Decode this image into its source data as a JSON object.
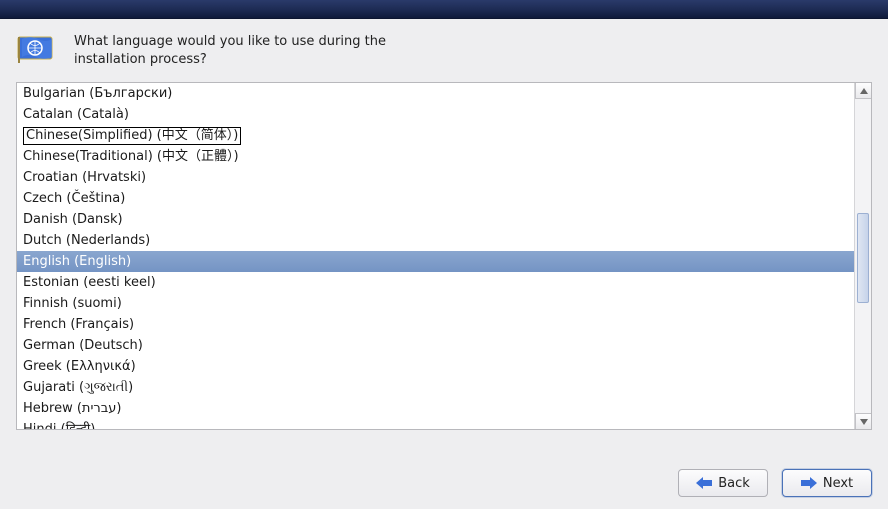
{
  "prompt": "What language would you like to use during the installation process?",
  "languages": [
    {
      "label": "Bulgarian (Български)",
      "selected": false,
      "boxed": false
    },
    {
      "label": "Catalan (Català)",
      "selected": false,
      "boxed": false
    },
    {
      "label": "Chinese(Simplified) (中文（简体）)",
      "selected": false,
      "boxed": true
    },
    {
      "label": "Chinese(Traditional) (中文（正體）)",
      "selected": false,
      "boxed": false
    },
    {
      "label": "Croatian (Hrvatski)",
      "selected": false,
      "boxed": false
    },
    {
      "label": "Czech (Čeština)",
      "selected": false,
      "boxed": false
    },
    {
      "label": "Danish (Dansk)",
      "selected": false,
      "boxed": false
    },
    {
      "label": "Dutch (Nederlands)",
      "selected": false,
      "boxed": false
    },
    {
      "label": "English (English)",
      "selected": true,
      "boxed": false
    },
    {
      "label": "Estonian (eesti keel)",
      "selected": false,
      "boxed": false
    },
    {
      "label": "Finnish (suomi)",
      "selected": false,
      "boxed": false
    },
    {
      "label": "French (Français)",
      "selected": false,
      "boxed": false
    },
    {
      "label": "German (Deutsch)",
      "selected": false,
      "boxed": false
    },
    {
      "label": "Greek (Ελληνικά)",
      "selected": false,
      "boxed": false
    },
    {
      "label": "Gujarati (ગુજરાતી)",
      "selected": false,
      "boxed": false
    },
    {
      "label": "Hebrew (עברית)",
      "selected": false,
      "boxed": false
    },
    {
      "label": "Hindi (हिन्दी)",
      "selected": false,
      "boxed": false
    }
  ],
  "buttons": {
    "back": "Back",
    "next": "Next"
  }
}
